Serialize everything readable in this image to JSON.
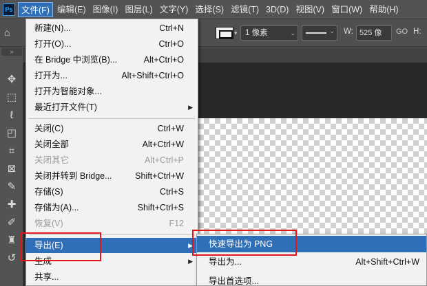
{
  "app": {
    "logo": "Ps"
  },
  "menubar": {
    "items": [
      "文件(F)",
      "编辑(E)",
      "图像(I)",
      "图层(L)",
      "文字(Y)",
      "选择(S)",
      "滤镜(T)",
      "3D(D)",
      "视图(V)",
      "窗口(W)",
      "帮助(H)"
    ],
    "active_index": 0
  },
  "options_bar": {
    "stroke_size": "1 像素",
    "w_label": "W:",
    "w_value": "525 像",
    "go_label": "GO",
    "h_label": "H:"
  },
  "toolbar": {
    "collapse_label": "»",
    "tools": [
      "move-icon",
      "marquee-icon",
      "lasso-icon",
      "object-select-icon",
      "crop-icon",
      "frame-icon",
      "eyedropper-icon",
      "healing-icon",
      "brush-icon",
      "stamp-icon",
      "history-brush-icon"
    ]
  },
  "file_menu": {
    "items": [
      {
        "label": "新建(N)...",
        "shortcut": "Ctrl+N"
      },
      {
        "label": "打开(O)...",
        "shortcut": "Ctrl+O"
      },
      {
        "label": "在 Bridge 中浏览(B)...",
        "shortcut": "Alt+Ctrl+O"
      },
      {
        "label": "打开为...",
        "shortcut": "Alt+Shift+Ctrl+O"
      },
      {
        "label": "打开为智能对象...",
        "shortcut": ""
      },
      {
        "label": "最近打开文件(T)",
        "shortcut": "",
        "submenu": true
      },
      {
        "label": "关闭(C)",
        "shortcut": "Ctrl+W"
      },
      {
        "label": "关闭全部",
        "shortcut": "Alt+Ctrl+W"
      },
      {
        "label": "关闭其它",
        "shortcut": "Alt+Ctrl+P",
        "disabled": true
      },
      {
        "label": "关闭并转到 Bridge...",
        "shortcut": "Shift+Ctrl+W"
      },
      {
        "label": "存储(S)",
        "shortcut": "Ctrl+S"
      },
      {
        "label": "存储为(A)...",
        "shortcut": "Shift+Ctrl+S"
      },
      {
        "label": "恢复(V)",
        "shortcut": "F12",
        "disabled": true
      },
      {
        "label": "导出(E)",
        "shortcut": "",
        "submenu": true,
        "highlighted": true
      },
      {
        "label": "生成",
        "shortcut": "",
        "submenu": true
      },
      {
        "label": "共享...",
        "shortcut": ""
      }
    ]
  },
  "export_submenu": {
    "items": [
      {
        "label": "快速导出为 PNG",
        "shortcut": "",
        "highlighted": true
      },
      {
        "label": "导出为...",
        "shortcut": "Alt+Shift+Ctrl+W"
      },
      {
        "label": "导出首选项...",
        "shortcut": ""
      }
    ]
  },
  "colors": {
    "highlight": "#2f6fb8",
    "annotation": "#e0161b",
    "menu_bg": "#f2f2f2",
    "ui_bg": "#535353"
  }
}
